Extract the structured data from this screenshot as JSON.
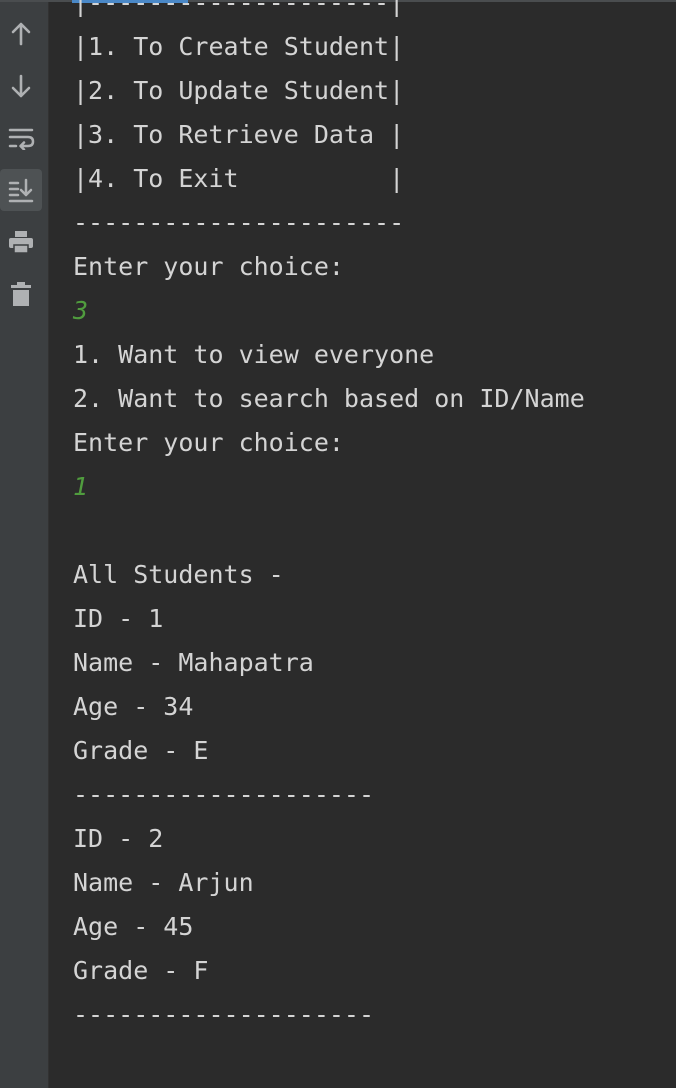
{
  "toolbar": {
    "buttons": [
      {
        "icon": "arrow-up-icon"
      },
      {
        "icon": "arrow-down-icon"
      },
      {
        "icon": "soft-wrap-icon"
      },
      {
        "icon": "scroll-to-end-icon",
        "active": true
      },
      {
        "icon": "print-icon"
      },
      {
        "icon": "trash-icon"
      }
    ]
  },
  "colors": {
    "background": "#2b2b2b",
    "toolbar": "#3c3f41",
    "output_text": "#d4d4d4",
    "input_text": "#509c3e",
    "scroll_thumb": "#4a88c7"
  },
  "console": {
    "menu_top_border": "|--------------------|",
    "menu_item_1": "|1. To Create Student|",
    "menu_item_2": "|2. To Update Student|",
    "menu_item_3": "|3. To Retrieve Data |",
    "menu_item_4": "|4. To Exit          |",
    "menu_bottom_border": "----------------------",
    "prompt_1": "Enter your choice:",
    "user_input_1": "3",
    "option_1": "1. Want to view everyone",
    "option_2": "2. Want to search based on ID/Name",
    "prompt_2": "Enter your choice:",
    "user_input_2": "1",
    "blank": "",
    "all_students_header": "All Students -",
    "students": [
      {
        "id": "ID - 1",
        "name": "Name - Mahapatra",
        "age": "Age - 34",
        "grade": "Grade - E"
      },
      {
        "id": "ID - 2",
        "name": "Name - Arjun",
        "age": "Age - 45",
        "grade": "Grade - F"
      }
    ],
    "separator": "--------------------"
  }
}
